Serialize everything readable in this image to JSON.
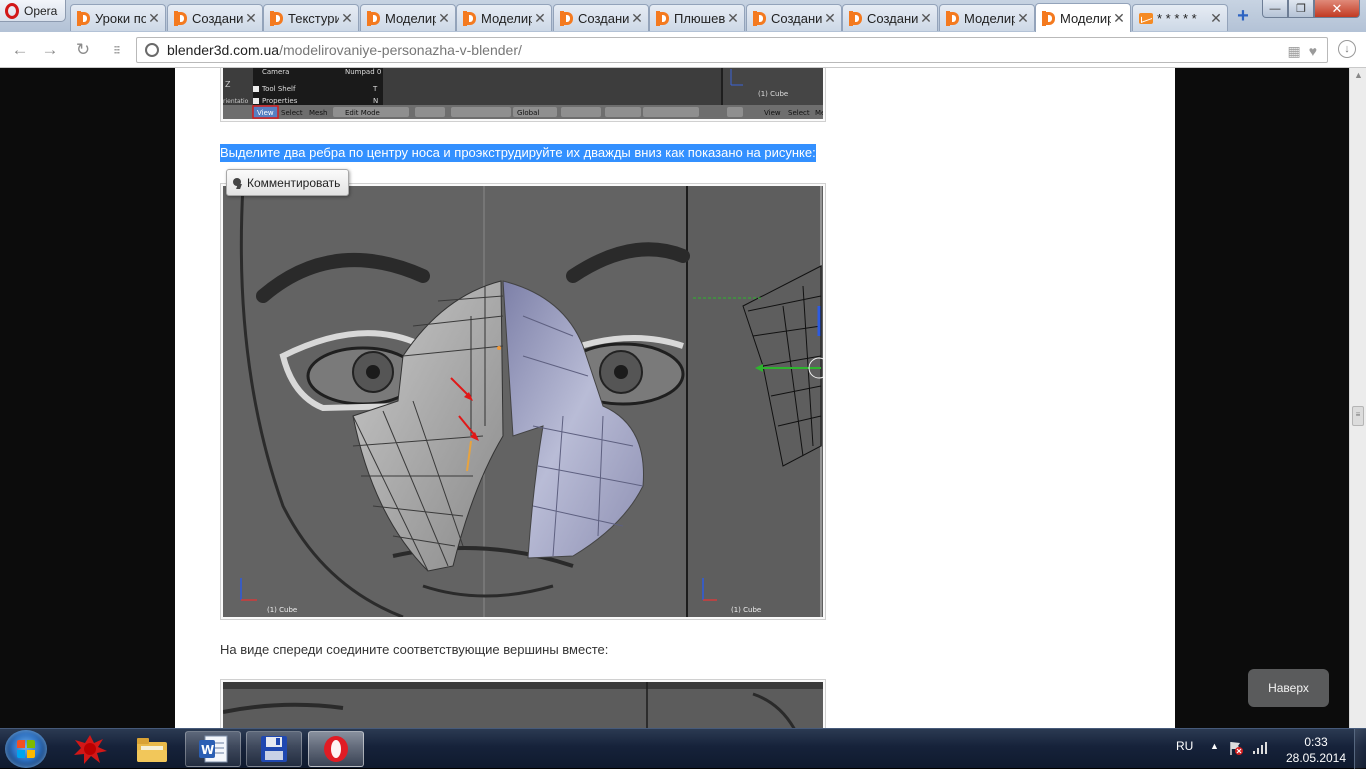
{
  "browser": {
    "app_label": "Opera",
    "tabs": [
      {
        "label": "Уроки по",
        "icon": "blender3d-favicon-icon",
        "active": false
      },
      {
        "label": "Создание",
        "icon": "blender3d-favicon-icon",
        "active": false
      },
      {
        "label": "Текстури",
        "icon": "blender3d-favicon-icon",
        "active": false
      },
      {
        "label": "Моделир",
        "icon": "blender3d-favicon-icon",
        "active": false
      },
      {
        "label": "Моделир",
        "icon": "blender3d-favicon-icon",
        "active": false
      },
      {
        "label": "Создание",
        "icon": "blender3d-favicon-icon",
        "active": false
      },
      {
        "label": "Плюшев",
        "icon": "blender3d-favicon-icon",
        "active": false
      },
      {
        "label": "Создание",
        "icon": "blender3d-favicon-icon",
        "active": false
      },
      {
        "label": "Создание",
        "icon": "blender3d-favicon-icon",
        "active": false
      },
      {
        "label": "Моделир",
        "icon": "blender3d-favicon-icon",
        "active": false
      },
      {
        "label": "Моделир",
        "icon": "blender3d-favicon-icon",
        "active": true
      },
      {
        "label": "* * * * *",
        "icon": "mail-favicon-icon",
        "active": false
      }
    ],
    "tab_close_glyph": "✕",
    "new_tab_glyph": "+",
    "url_host": "blender3d.com.ua",
    "url_path": "/modelirovaniye-personazha-v-blender/",
    "win_controls": {
      "minimize": "—",
      "maximize": "❐",
      "close": "✕"
    },
    "nav": {
      "back": "←",
      "forward": "→",
      "reload": "↻",
      "speed_dial": "⁝⁝⁝"
    }
  },
  "article": {
    "fig1": {
      "menu_items": [
        {
          "label": "Camera",
          "shortcut": "Numpad 0"
        },
        {
          "label": "Tool Shelf",
          "shortcut": "T"
        },
        {
          "label": "Properties",
          "shortcut": "N"
        }
      ],
      "header_buttons": [
        "View",
        "Select",
        "Mesh"
      ],
      "mode": "Edit Mode",
      "orientation": "Global",
      "right_header_buttons": [
        "View",
        "Select",
        "Me"
      ],
      "object_label": "(1) Cube",
      "axis_label": "Z",
      "side_label": "rientatio"
    },
    "para1": "Выделите два ребра по центру носа и проэкструдируйте их дважды вниз как показано на рисунке:",
    "comment_tooltip": "Комментировать",
    "fig2": {
      "left_view_label": "(1) Cube",
      "right_view_label": "(1) Cube"
    },
    "para2": "На виде спереди соедините соответствующие вершины вместе:",
    "to_top": "Наверх"
  },
  "taskbar": {
    "apps": [
      {
        "name": "red-splat-app-icon",
        "state": "none"
      },
      {
        "name": "file-explorer-icon",
        "state": "none"
      },
      {
        "name": "word-icon",
        "state": "open"
      },
      {
        "name": "floppy-save-icon",
        "state": "open"
      },
      {
        "name": "opera-icon",
        "state": "active"
      }
    ],
    "language": "RU",
    "tray_arrow": "▲",
    "time": "0:33",
    "date": "28.05.2014"
  },
  "colors": {
    "selection": "#3390ff",
    "blender_orange": "#f47a1f",
    "taskbar": "#16223a"
  }
}
